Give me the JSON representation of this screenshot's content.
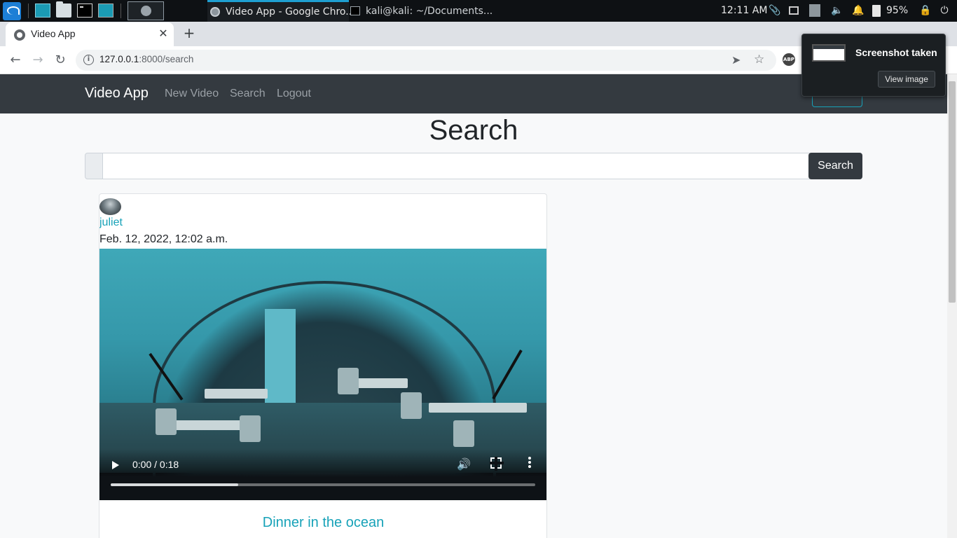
{
  "taskbar": {
    "tasks": [
      {
        "label": "Video App - Google Chro..."
      },
      {
        "label": "kali@kali: ~/Documents..."
      }
    ],
    "clock": "12:11 AM",
    "battery": "95%"
  },
  "browser": {
    "tab_title": "Video App",
    "url_host": "127.0.0.1",
    "url_rest": ":8000/search"
  },
  "navbar": {
    "brand": "Video App",
    "links": [
      "New Video",
      "Search",
      "Logout"
    ]
  },
  "page": {
    "title": "Search",
    "search": {
      "value": "",
      "button": "Search"
    }
  },
  "post": {
    "username": "juliet",
    "date": "Feb. 12, 2022, 12:02 a.m.",
    "video_time": "0:00 / 0:18",
    "progress_buffered": 0.3,
    "title": "Dinner in the ocean"
  },
  "notification": {
    "title": "Screenshot taken",
    "button": "View image"
  },
  "colors": {
    "navbar": "#343a40",
    "accent": "#17a2b8",
    "page_bg": "#f8f9fa"
  }
}
